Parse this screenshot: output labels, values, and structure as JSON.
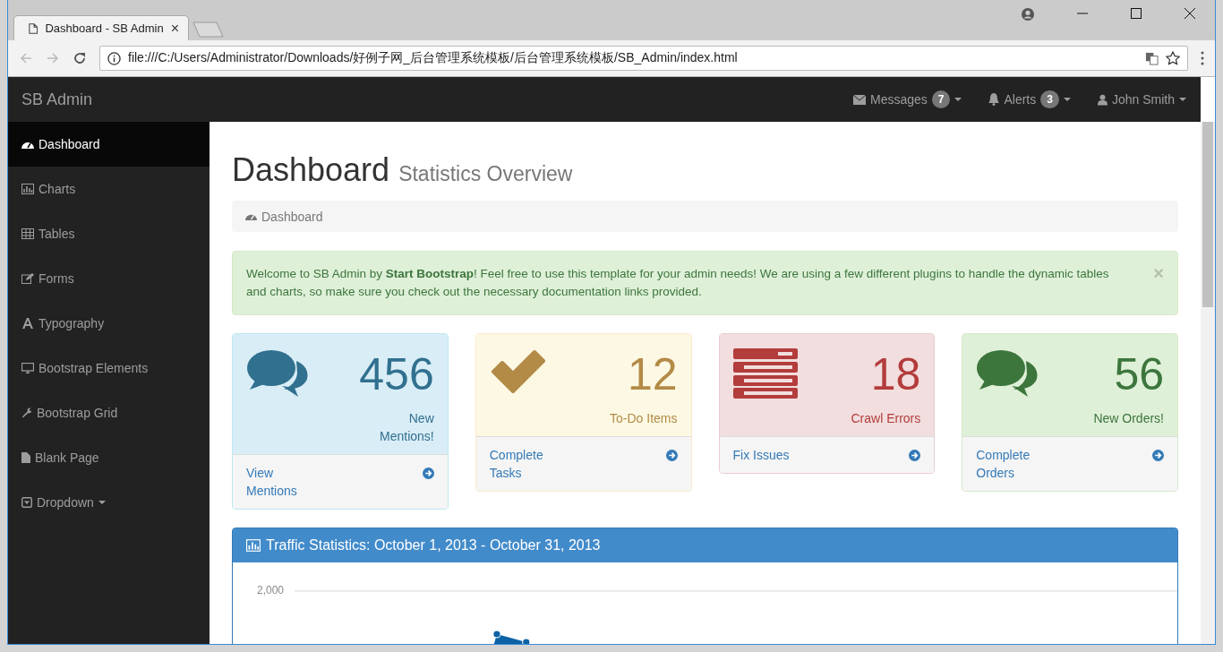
{
  "browser": {
    "tab_title": "Dashboard - SB Admin",
    "tab_close": "×",
    "url": "file:///C:/Users/Administrator/Downloads/好例子网_后台管理系统模板/后台管理系统模板/SB_Admin/index.html"
  },
  "navbar": {
    "brand": "SB Admin",
    "items": [
      {
        "label": "Messages",
        "badge": "7"
      },
      {
        "label": "Alerts",
        "badge": "3"
      },
      {
        "label": "John Smith"
      }
    ]
  },
  "sidebar": {
    "items": [
      {
        "label": "Dashboard",
        "selected": true
      },
      {
        "label": "Charts",
        "selected": false
      },
      {
        "label": "Tables",
        "selected": false
      },
      {
        "label": "Forms",
        "selected": false
      },
      {
        "label": "Typography",
        "selected": false
      },
      {
        "label": "Bootstrap Elements",
        "selected": false
      },
      {
        "label": "Bootstrap Grid",
        "selected": false
      },
      {
        "label": "Blank Page",
        "selected": false
      },
      {
        "label": "Dropdown",
        "selected": false,
        "caret": true
      }
    ]
  },
  "page": {
    "title": "Dashboard",
    "subtitle": "Statistics Overview",
    "breadcrumb": "Dashboard",
    "alert": {
      "text": "Welcome to SB Admin by **Start Bootstrap**! Feel free to use this template for your admin needs! We are using a few different plugins to handle the dynamic tables and charts, so make sure you check out the necessary documentation links provided.",
      "dismiss": "×"
    },
    "cards": [
      {
        "kind": "info",
        "count": "456",
        "label": "New Mentions!",
        "link": "View Mentions"
      },
      {
        "kind": "warning",
        "count": "12",
        "label": "To-Do Items",
        "link": "Complete Tasks"
      },
      {
        "kind": "danger",
        "count": "18",
        "label": "Crawl Errors",
        "link": "Fix Issues"
      },
      {
        "kind": "success",
        "count": "56",
        "label": "New Orders!",
        "link": "Complete Orders"
      }
    ],
    "traffic": {
      "title": "Traffic Statistics: October 1, 2013 - October 31, 2013",
      "tick": "2,000"
    }
  }
}
